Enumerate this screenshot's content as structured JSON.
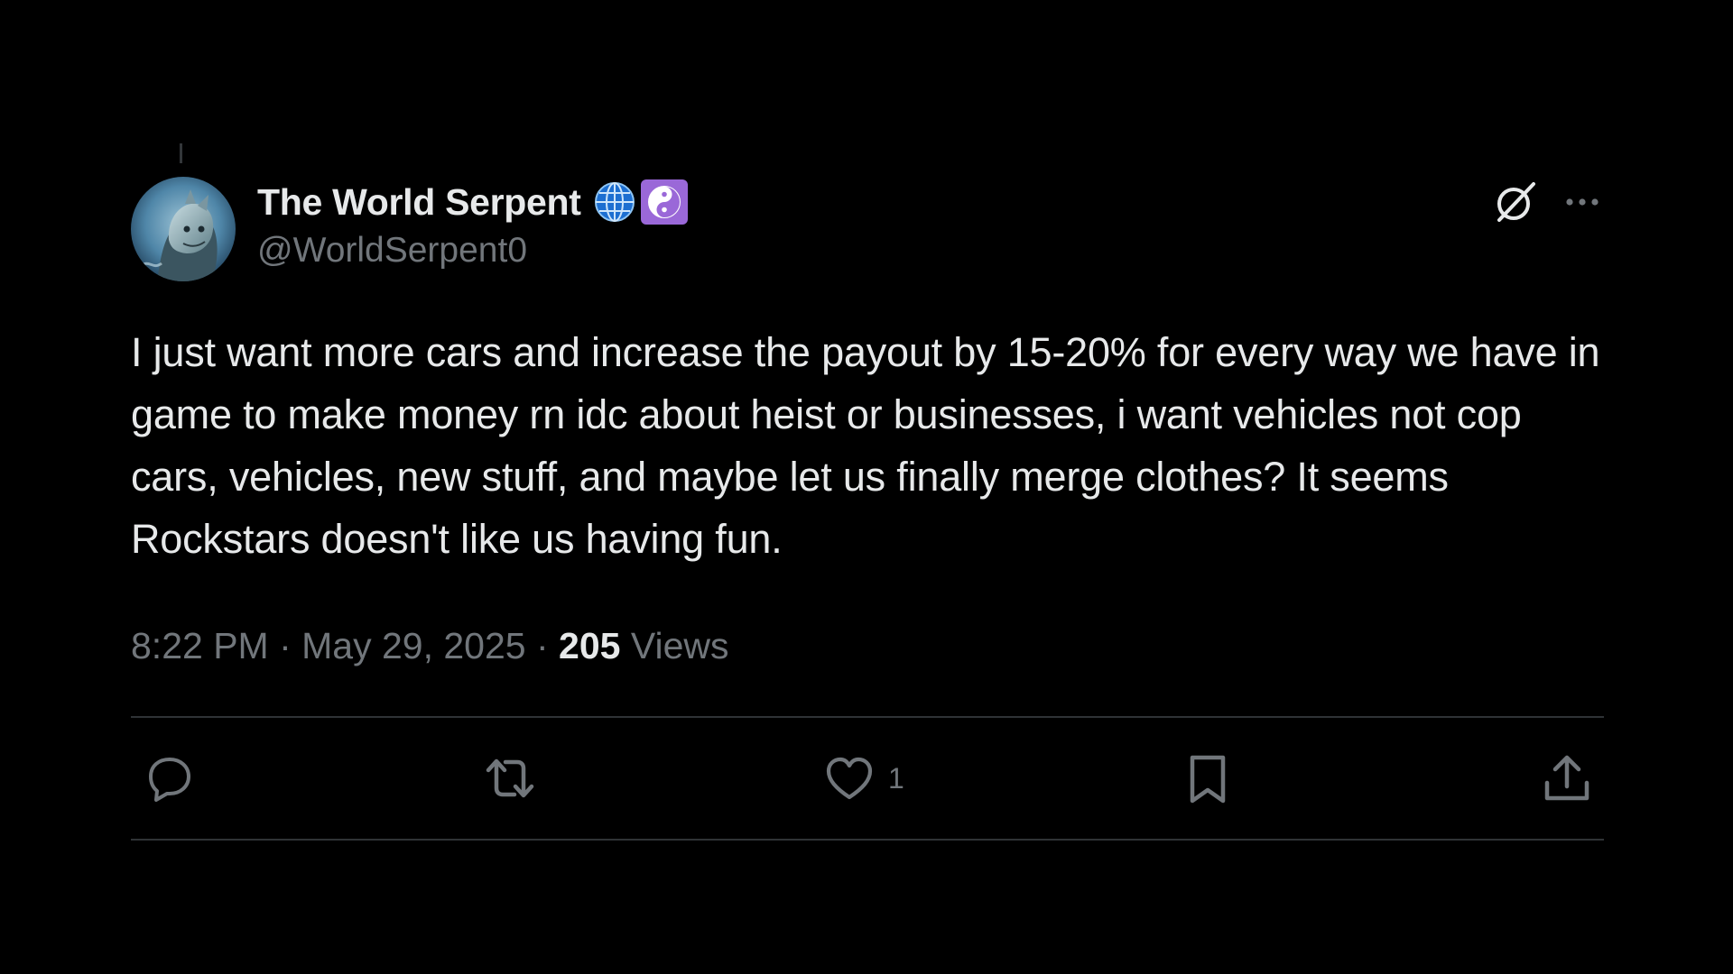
{
  "author": {
    "display_name": "The World Serpent",
    "handle": "@WorldSerpent0",
    "badges": [
      "globe-icon",
      "yin-yang-icon"
    ]
  },
  "tweet": {
    "text": "I just want more cars and increase the payout by 15-20% for every way we have in game to make money rn idc about heist or businesses, i want vehicles not cop cars, vehicles, new stuff, and maybe let us finally merge clothes? It seems Rockstars doesn't like us having fun.",
    "time": "8:22 PM",
    "separator": " · ",
    "date": "May 29, 2025",
    "views_count": "205",
    "views_label": "Views"
  },
  "actions": {
    "reply_count": "",
    "retweet_count": "",
    "like_count": "1"
  },
  "colors": {
    "background": "#000000",
    "primary_text": "#e7e9ea",
    "secondary_text": "#71767b",
    "divider": "#2f3336",
    "badge_purple": "#9a68d8",
    "globe_blue": "#1d6fd1"
  }
}
